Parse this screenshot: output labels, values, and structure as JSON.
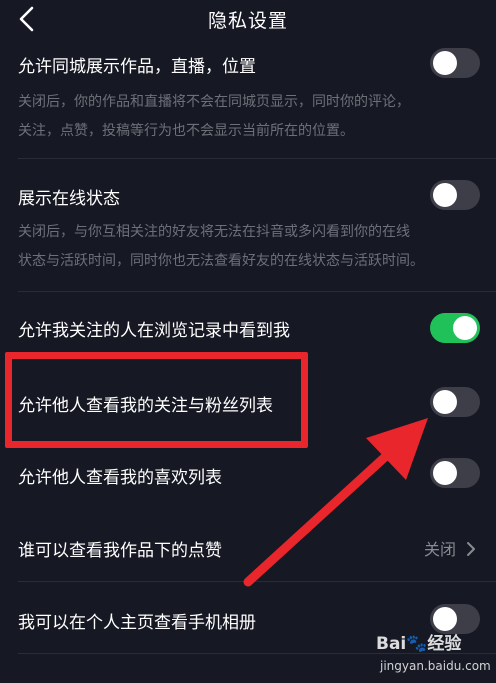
{
  "header": {
    "title": "隐私设置",
    "back_icon": "chevron-left-icon"
  },
  "settings": [
    {
      "label": "允许同城展示作品，直播，位置",
      "desc_lines": [
        "关闭后，你的作品和直播将不会在同城页显示，同时你的评论，",
        "关注，点赞，投稿等行为也不会显示当前所在的位置。"
      ],
      "toggle": "off"
    },
    {
      "label": "展示在线状态",
      "desc_lines": [
        "关闭后，与你互相关注的好友将无法在抖音或多闪看到你的在线",
        "状态与活跃时间，同时你也无法查看好友的在线状态与活跃时间。"
      ],
      "toggle": "off"
    },
    {
      "label": "允许我关注的人在浏览记录中看到我",
      "toggle": "on"
    },
    {
      "label": "允许他人查看我的关注与粉丝列表",
      "toggle": "off"
    },
    {
      "label": "允许他人查看我的喜欢列表",
      "toggle": "off"
    },
    {
      "label": "谁可以查看我作品下的点赞",
      "value": "关闭"
    },
    {
      "label": "我可以在个人主页查看手机相册",
      "toggle": "off"
    }
  ],
  "colors": {
    "background": "#161823",
    "toggle_on": "#21c15a",
    "toggle_off": "#3d3e48",
    "annotation_red": "#e8262b"
  },
  "watermark": {
    "logo": "Bai🐾经验",
    "url": "jingyan.baidu.com"
  }
}
